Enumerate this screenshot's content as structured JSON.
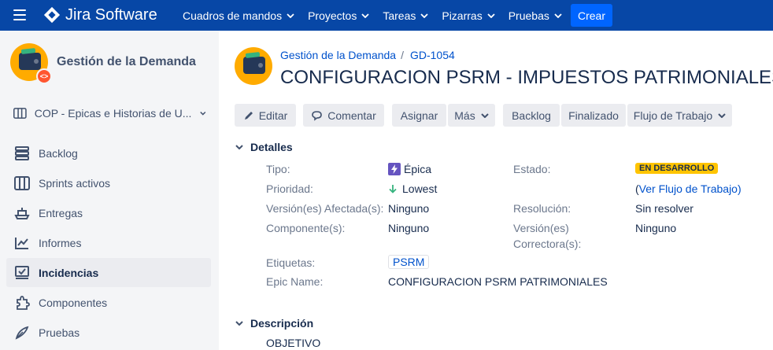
{
  "topnav": {
    "logo_text": "Jira Software",
    "items": [
      {
        "label": "Cuadros de mandos"
      },
      {
        "label": "Proyectos"
      },
      {
        "label": "Tareas"
      },
      {
        "label": "Pizarras"
      },
      {
        "label": "Pruebas"
      }
    ],
    "create_label": "Crear",
    "colors": {
      "bar": "#0747a6",
      "create": "#0065ff"
    }
  },
  "sidebar": {
    "project_name": "Gestión de la Demanda",
    "board_name": "COP - Epicas e Historias de U...",
    "items": [
      {
        "label": "Backlog",
        "icon": "backlog-icon"
      },
      {
        "label": "Sprints activos",
        "icon": "board-icon"
      },
      {
        "label": "Entregas",
        "icon": "ship-icon"
      },
      {
        "label": "Informes",
        "icon": "chart-icon"
      },
      {
        "label": "Incidencias",
        "icon": "issues-icon",
        "active": true
      },
      {
        "label": "Componentes",
        "icon": "puzzle-icon"
      },
      {
        "label": "Pruebas",
        "icon": "feather-icon"
      }
    ]
  },
  "issue": {
    "breadcrumb_project": "Gestión de la Demanda",
    "breadcrumb_sep": "/",
    "key": "GD-1054",
    "title": "CONFIGURACION PSRM - IMPUESTOS PATRIMONIALES"
  },
  "toolbar": {
    "edit": "Editar",
    "comment": "Comentar",
    "assign": "Asignar",
    "more": "Más",
    "backlog": "Backlog",
    "done": "Finalizado",
    "workflow": "Flujo de Trabajo"
  },
  "details": {
    "heading": "Detalles",
    "type_label": "Tipo:",
    "type_value": "Épica",
    "priority_label": "Prioridad:",
    "priority_value": "Lowest",
    "affects_label": "Versión(es) Afectada(s):",
    "affects_value": "Ninguno",
    "component_label": "Componente(s):",
    "component_value": "Ninguno",
    "labels_label": "Etiquetas:",
    "labels_value": "PSRM",
    "epic_name_label": "Epic Name:",
    "epic_name_value": "CONFIGURACION PSRM PATRIMONIALES",
    "status_label": "Estado:",
    "status_value": "EN DESARROLLO",
    "workflow_link_pre": "(",
    "workflow_link": "Ver Flujo de Trabajo",
    "workflow_link_post": ")",
    "resolution_label": "Resolución:",
    "resolution_value": "Sin resolver",
    "fix_label_1": "Versión(es)",
    "fix_label_2": "Correctora(s):",
    "fix_value": "Ninguno",
    "status_color": "#ffc400"
  },
  "description": {
    "heading": "Descripción",
    "first_line": "OBJETIVO"
  }
}
